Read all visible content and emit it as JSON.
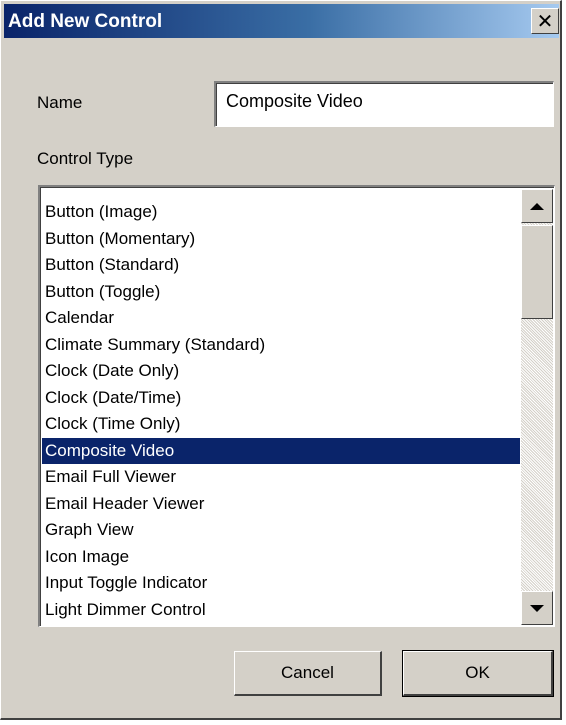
{
  "window": {
    "title": "Add New Control",
    "close_glyph": "✕"
  },
  "form": {
    "name_label": "Name",
    "name_value": "Composite Video",
    "control_type_label": "Control Type"
  },
  "list": {
    "items": [
      "Button (Image)",
      "Button (Momentary)",
      "Button (Standard)",
      "Button (Toggle)",
      "Calendar",
      "Climate Summary (Standard)",
      "Clock (Date Only)",
      "Clock (Date/Time)",
      "Clock (Time Only)",
      "Composite Video",
      "Email Full Viewer",
      "Email Header Viewer",
      "Graph View",
      "Icon Image",
      "Input Toggle Indicator",
      "Light Dimmer Control"
    ],
    "selected_index": 9
  },
  "buttons": {
    "cancel_label": "Cancel",
    "ok_label": "OK"
  },
  "colors": {
    "selection_bg": "#0a246a",
    "title_gradient_start": "#0a246a",
    "title_gradient_end": "#a6caf0",
    "dialog_bg": "#d4d0c8"
  },
  "icons": {
    "close": "close-icon",
    "scroll_up": "arrow-up-icon",
    "scroll_down": "arrow-down-icon"
  }
}
